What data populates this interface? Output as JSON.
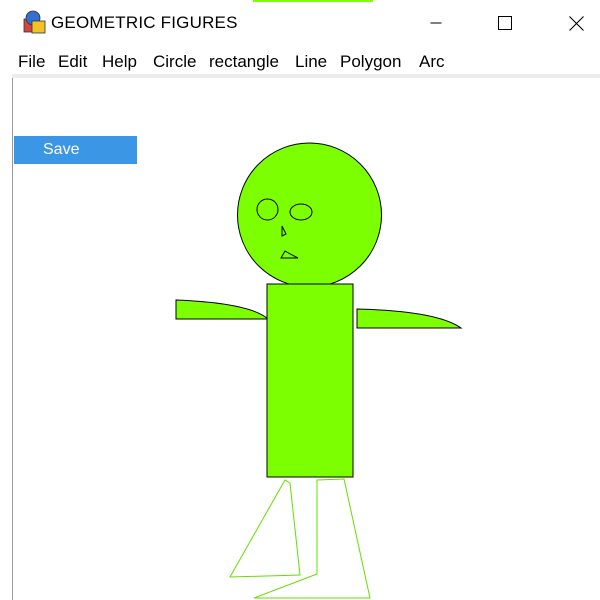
{
  "window": {
    "title": "GEOMETRIC FIGURES",
    "app_icon": "geometric-shapes-icon",
    "controls": {
      "minimize_icon": "minimize-icon",
      "maximize_icon": "maximize-icon",
      "close_icon": "close-icon"
    }
  },
  "menu": {
    "items": [
      {
        "label": "File"
      },
      {
        "label": "Edit"
      },
      {
        "label": "Help"
      },
      {
        "label": "Circle"
      },
      {
        "label": "rectangle"
      },
      {
        "label": "Line"
      },
      {
        "label": "Polygon"
      },
      {
        "label": "Arc"
      }
    ]
  },
  "toolbar": {
    "save_label": "Save"
  },
  "colors": {
    "figure_fill": "#7cff00",
    "figure_stroke": "#000000",
    "leg_stroke": "#66dd00",
    "save_button_bg": "#3c96e6",
    "save_button_text": "#ffffff"
  }
}
